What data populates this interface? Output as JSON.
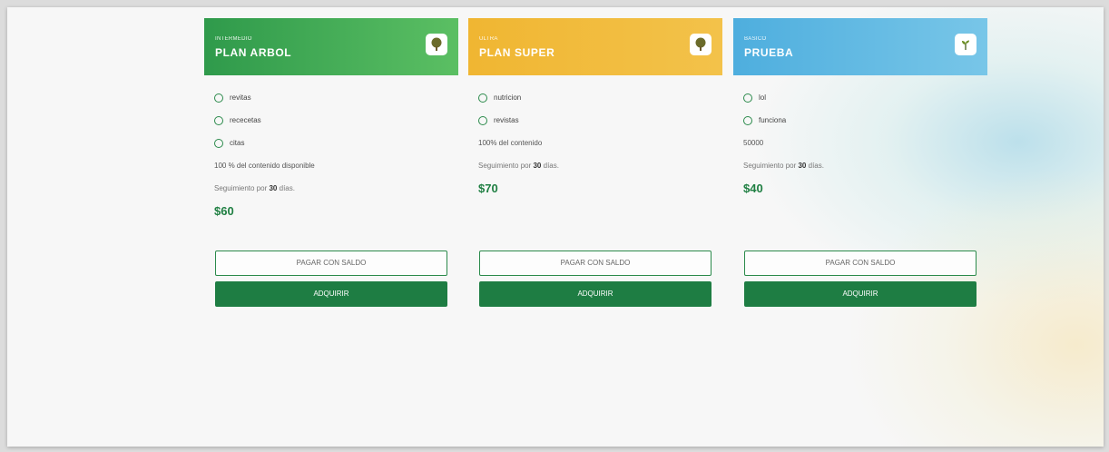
{
  "plans": [
    {
      "tier": "INTERMEDIO",
      "name": "PLAN ARBOL",
      "color": "#4caf50",
      "icon": "tree-icon",
      "features": [
        "revitas",
        "rececetas",
        "citas"
      ],
      "info": "100 % del contenido disponible",
      "follow_prefix": "Seguimiento por ",
      "follow_days": "30",
      "follow_suffix": " días.",
      "price": "$60",
      "balance_button": "PAGAR CON SALDO",
      "buy_button": "ADQUIRIR"
    },
    {
      "tier": "ULTRA",
      "name": "PLAN SUPER",
      "color": "#f2b938",
      "icon": "tree-icon",
      "features": [
        "nutricion",
        "revistas"
      ],
      "info": "100% del contenido",
      "follow_prefix": "Seguimiento por ",
      "follow_days": "30",
      "follow_suffix": " días.",
      "price": "$70",
      "balance_button": "PAGAR CON SALDO",
      "buy_button": "ADQUIRIR"
    },
    {
      "tier": "BASICO",
      "name": "PRUEBA",
      "color": "#5ab5e2",
      "icon": "sprout-icon",
      "features": [
        "lol",
        "funciona"
      ],
      "info": "50000",
      "follow_prefix": "Seguimiento por ",
      "follow_days": "30",
      "follow_suffix": " días.",
      "price": "$40",
      "balance_button": "PAGAR CON SALDO",
      "buy_button": "ADQUIRIR"
    }
  ]
}
